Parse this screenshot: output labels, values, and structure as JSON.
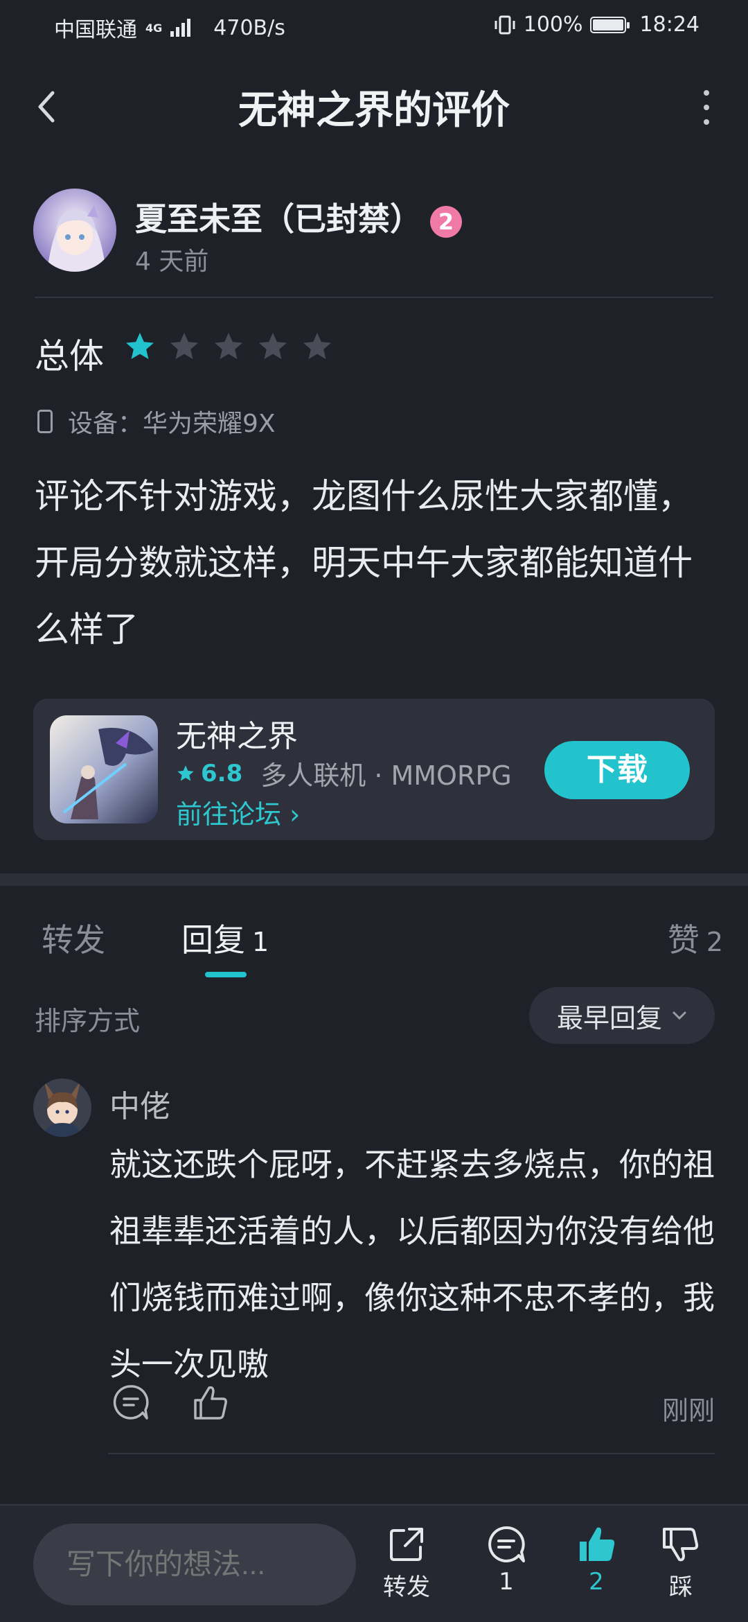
{
  "status_bar": {
    "carrier": "中国联通",
    "network": "4G",
    "speed": "470B/s",
    "battery": "100%",
    "time": "18:24"
  },
  "header": {
    "title": "无神之界的评价"
  },
  "review": {
    "author": "夏至未至（已封禁）",
    "level": "2",
    "time": "4 天前",
    "rating_label": "总体",
    "rating": 1,
    "rating_max": 5,
    "device": "设备：华为荣耀9X",
    "text": "评论不针对游戏，龙图什么尿性大家都懂，开局分数就这样，明天中午大家都能知道什么样了"
  },
  "game": {
    "name": "无神之界",
    "score": "6.8",
    "tags": "多人联机 · MMORPG",
    "forum_link": "前往论坛 ›",
    "download": "下载"
  },
  "tabs": {
    "forward": "转发",
    "reply": "回复",
    "reply_count": "1",
    "like": "赞",
    "like_count": "2"
  },
  "sort": {
    "label": "排序方式",
    "value": "最早回复"
  },
  "replies": [
    {
      "name": "中佬",
      "text": "就这还跌个屁呀，不赶紧去多烧点，你的祖祖辈辈还活着的人，以后都因为你没有给他们烧钱而难过啊，像你这种不忠不孝的，我头一次见嗷",
      "time": "刚刚"
    }
  ],
  "bottom_bar": {
    "input_placeholder": "写下你的想法...",
    "forward": "转发",
    "comment_count": "1",
    "like_count": "2",
    "dislike": "踩"
  },
  "colors": {
    "accent": "#22c3cc",
    "background": "#1f2129",
    "card": "#2e313b",
    "badge": "#f07aa6"
  }
}
